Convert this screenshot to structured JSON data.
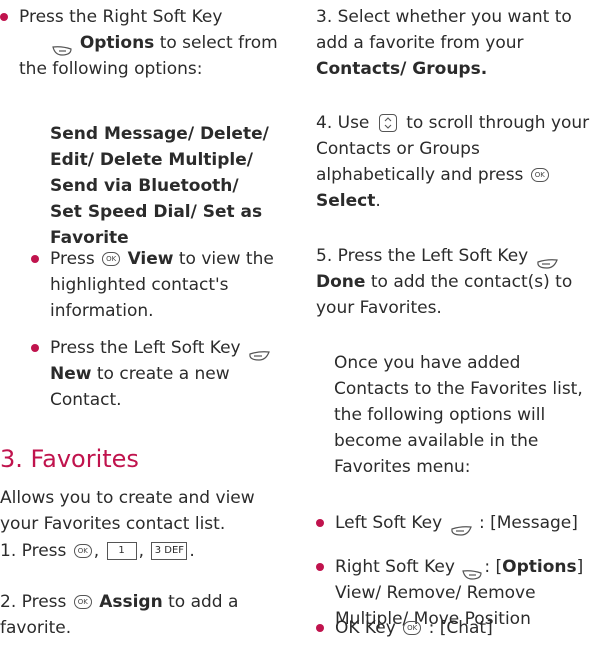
{
  "left": {
    "b1": {
      "pre": "Press the Right Soft Key",
      "strong": "Options",
      "post": "to select from the following options:",
      "opt1": "Send Message/ Delete/",
      "opt2": "Edit/ Delete Multiple/",
      "opt3": "Send via Bluetooth/",
      "opt4": "Set Speed Dial/ Set as",
      "opt5": "Favorite"
    },
    "b2": {
      "pre": "Press",
      "strong": "View",
      "post": "to view the highlighted contact's information."
    },
    "b3": {
      "pre": "Press the Left Soft Key",
      "strong": "New",
      "post": "to create a new Contact."
    },
    "heading": "3. Favorites",
    "intro": "Allows you to create and view your Favorites contact list.",
    "s1": {
      "pre": "1. Press",
      "sep1": ",",
      "key1": "1",
      "sep2": ",",
      "key2": "3 DEF",
      "end": "."
    },
    "s2": {
      "pre": "2. Press",
      "strong": "Assign",
      "post": "to add a favorite."
    }
  },
  "right": {
    "s3": {
      "text": "3. Select whether you want to add a favorite from your",
      "strong": "Contacts/ Groups."
    },
    "s4": {
      "pre": "4. Use",
      "mid": "to scroll through your Contacts or Groups alphabetically and press",
      "strong": "Select",
      "end": "."
    },
    "s5": {
      "pre": "5. Press the Left Soft Key",
      "strong": "Done",
      "post": "to add the contact(s) to your Favorites."
    },
    "note": "Once you have added Contacts to the Favorites list, the following options will become available in the Favorites menu:",
    "o1": {
      "pre": "Left Soft Key",
      "post": ": [Message]"
    },
    "o2": {
      "pre": "Right Soft Key",
      "mid": ": [",
      "strong": "Options",
      "end": "]",
      "line2": "View/ Remove/ Remove Multiple/ Move Position"
    },
    "o3": {
      "pre": "OK Key",
      "post": ": [Chat]"
    }
  },
  "icons": {
    "ok": "OK",
    "accent": "#c0134d"
  }
}
